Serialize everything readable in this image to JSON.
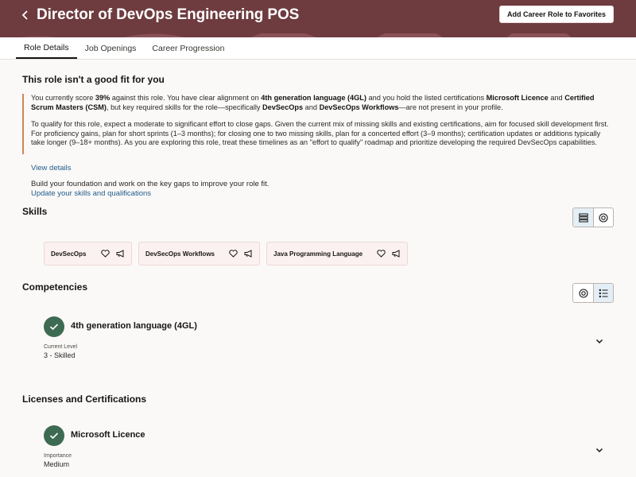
{
  "header": {
    "title": "Director of DevOps Engineering POS",
    "favorites_button": "Add Career Role to Favorites"
  },
  "tabs": [
    {
      "label": "Role Details",
      "active": true
    },
    {
      "label": "Job Openings",
      "active": false
    },
    {
      "label": "Career Progression",
      "active": false
    }
  ],
  "fit": {
    "title": "This role isn't a good fit for you",
    "p1_a": "You currently score ",
    "p1_score": "39%",
    "p1_b": " against this role. You have clear alignment on ",
    "p1_comp": "4th generation language (4GL)",
    "p1_c": " and you hold the listed certifications ",
    "p1_cert1": "Microsoft Licence",
    "p1_d": " and ",
    "p1_cert2": "Certified Scrum Masters (CSM)",
    "p1_e": ", but key required skills for the role—specifically ",
    "p1_skill1": "DevSecOps",
    "p1_f": " and ",
    "p1_skill2": "DevSecOps Workflows",
    "p1_g": "—are not present in your profile.",
    "p2": "To qualify for this role, expect a moderate to significant effort to close gaps. Given the current mix of missing skills and existing certifications, aim for focused skill development first. For proficiency gains, plan for short sprints (1–3 months); for closing one to two missing skills, plan for a concerted effort (3–9 months); certification updates or additions typically take longer (9–18+ months). As you are exploring this role, treat these timelines as an \"effort to qualify\" roadmap and prioritize developing the required DevSecOps capabilities.",
    "view_details": "View details",
    "foundation_text": "Build your foundation and work on the key gaps to improve your role fit.",
    "update_link": "Update your skills and qualifications"
  },
  "skills": {
    "title": "Skills",
    "items": [
      {
        "name": "DevSecOps"
      },
      {
        "name": "DevSecOps Workflows"
      },
      {
        "name": "Java Programming Language"
      }
    ]
  },
  "competencies": {
    "title": "Competencies",
    "items": [
      {
        "name": "4th generation language (4GL)",
        "level_label": "Current Level",
        "level_value": "3 - Skilled"
      }
    ]
  },
  "licenses": {
    "title": "Licenses and Certifications",
    "items": [
      {
        "name": "Microsoft Licence",
        "importance_label": "Importance",
        "importance_value": "Medium"
      }
    ]
  },
  "colors": {
    "header_bg": "#6e3b3f",
    "accent_border": "#d98353",
    "link": "#1f5c8b",
    "check_green": "#3d6b52",
    "chip_bg": "#fbf1f0"
  }
}
